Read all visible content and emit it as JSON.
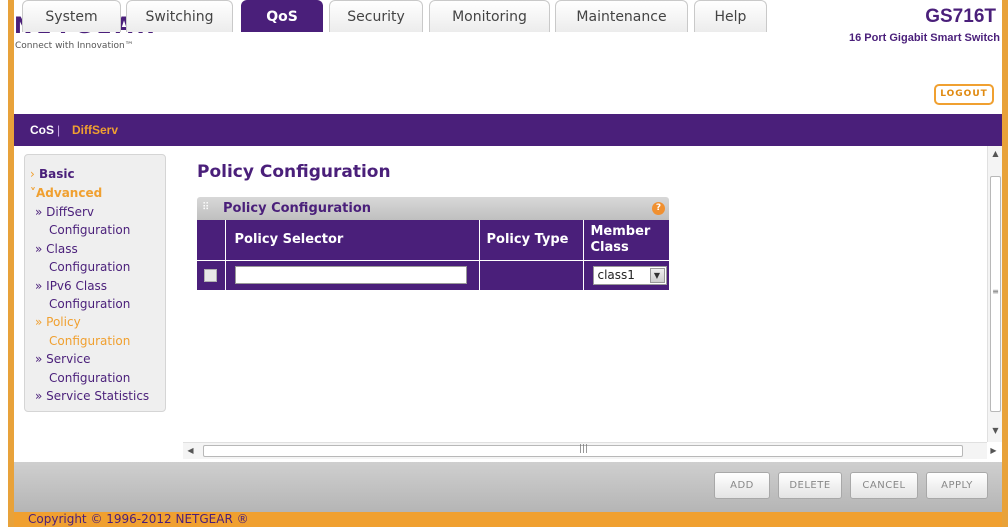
{
  "brand": {
    "logo": "NETGEAR",
    "logo_mark": "®",
    "tagline": "Connect with Innovation™",
    "model": "GS716T",
    "model_desc": "16 Port Gigabit Smart Switch"
  },
  "tabs": [
    {
      "label": "System"
    },
    {
      "label": "Switching"
    },
    {
      "label": "QoS"
    },
    {
      "label": "Security"
    },
    {
      "label": "Monitoring"
    },
    {
      "label": "Maintenance"
    },
    {
      "label": "Help"
    }
  ],
  "logout_label": "LOGOUT",
  "subnav": {
    "cos": "CoS",
    "sep": "|",
    "diffserv": "DiffServ"
  },
  "leftnav": {
    "basic": "Basic",
    "advanced": "Advanced",
    "items": [
      {
        "line1": "» DiffServ",
        "line2": "Configuration"
      },
      {
        "line1": "» Class",
        "line2": "Configuration"
      },
      {
        "line1": "» IPv6 Class",
        "line2": "Configuration"
      },
      {
        "line1": "» Policy",
        "line2": "Configuration"
      },
      {
        "line1": "» Service",
        "line2": "Configuration"
      },
      {
        "line1": "» Service Statistics",
        "line2": ""
      }
    ]
  },
  "main": {
    "title": "Policy Configuration",
    "panel_title": "Policy Configuration",
    "help": "?",
    "table": {
      "headers": {
        "selector": "Policy Selector",
        "type": "Policy Type",
        "member_line1": "Member",
        "member_line2": "Class"
      },
      "row": {
        "selector_value": "",
        "type_value": "",
        "member_class": "class1"
      }
    }
  },
  "buttons": {
    "add": "ADD",
    "delete": "DELETE",
    "cancel": "CANCEL",
    "apply": "APPLY"
  },
  "copyright": "Copyright © 1996-2012 NETGEAR ®",
  "colors": {
    "brand_purple": "#4a1f7a",
    "accent_orange": "#f0a030"
  }
}
